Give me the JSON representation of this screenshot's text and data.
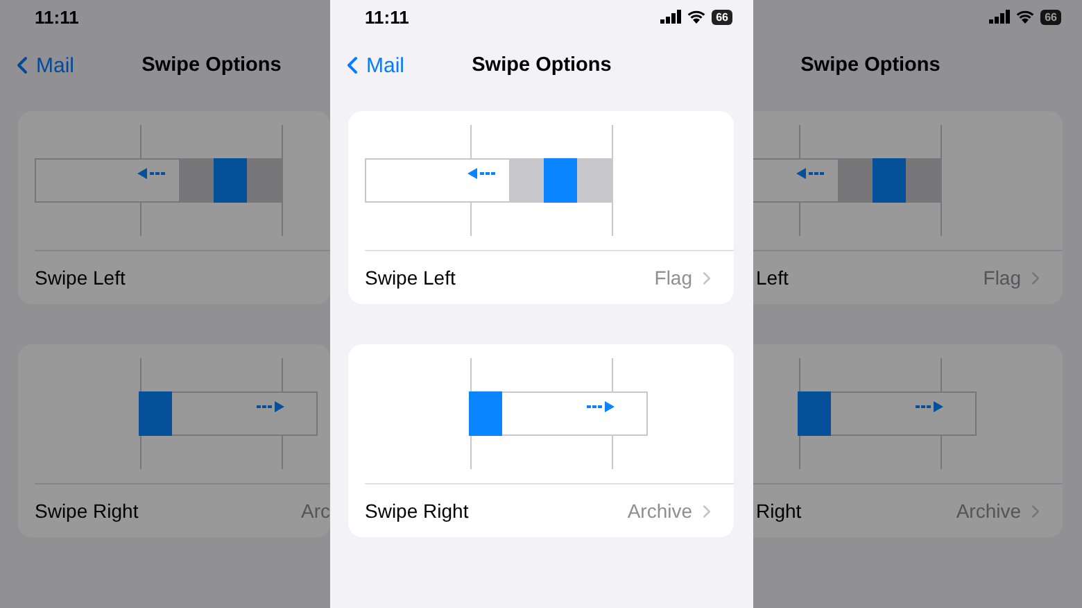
{
  "status_bar": {
    "time": "11:11",
    "battery": "66"
  },
  "nav": {
    "back": "Mail",
    "title": "Swipe Options"
  },
  "options": [
    {
      "kind": "left",
      "label": "Swipe Left",
      "value": "Flag"
    },
    {
      "kind": "right",
      "label": "Swipe Right",
      "value": "Archive"
    }
  ],
  "backdrop": {
    "left": {
      "status_bar": {
        "time": "11:11"
      },
      "nav": {
        "back": "Mail",
        "title": "Swipe Options"
      },
      "options": [
        {
          "kind": "left",
          "label": "Swipe Left"
        },
        {
          "kind": "right",
          "label": "Swipe Right",
          "value": "Arc"
        }
      ]
    },
    "right": {
      "status_bar": {
        "battery": "66"
      },
      "nav": {
        "title": "Swipe Options"
      },
      "options": [
        {
          "kind": "left",
          "label": "Left",
          "value": "Flag"
        },
        {
          "kind": "right",
          "label": "Right",
          "value": "Archive"
        }
      ]
    }
  }
}
